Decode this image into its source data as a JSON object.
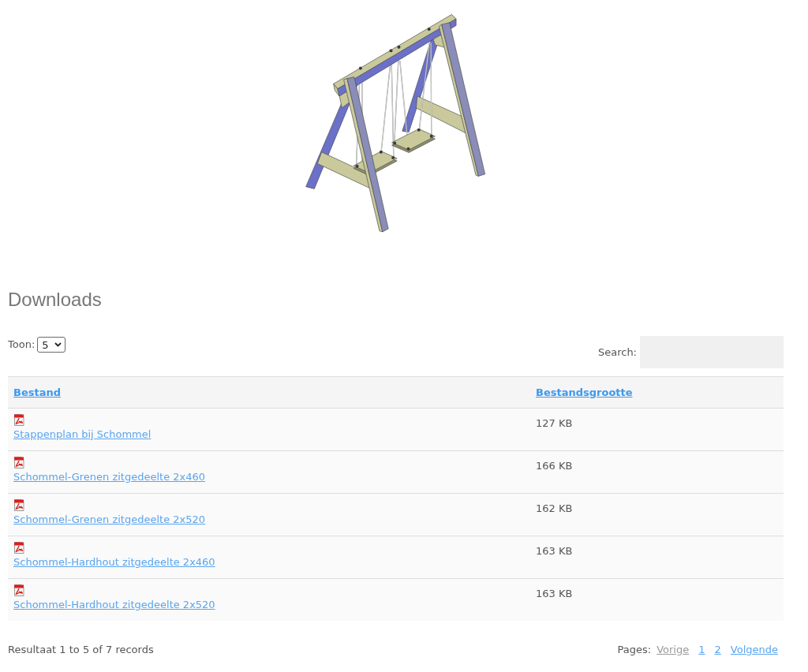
{
  "heading": "Downloads",
  "page_size": {
    "label": "Toon:",
    "value": "5"
  },
  "search": {
    "label": "Search:"
  },
  "table": {
    "columns": [
      "Bestand",
      "Bestandsgrootte"
    ],
    "rows": [
      {
        "file": "Stappenplan bij Schommel",
        "size": "127 KB"
      },
      {
        "file": "Schommel-Grenen zitgedeelte 2x460",
        "size": "166 KB"
      },
      {
        "file": "Schommel-Grenen zitgedeelte 2x520",
        "size": "162 KB"
      },
      {
        "file": "Schommel-Hardhout zitgedeelte 2x460",
        "size": "163 KB"
      },
      {
        "file": "Schommel-Hardhout zitgedeelte 2x520",
        "size": "163 KB"
      }
    ]
  },
  "footer": {
    "summary": "Resultaat 1 to 5 of 7 records",
    "pages_label": "Pages:",
    "links": [
      {
        "label": "Vorige",
        "disabled": true
      },
      {
        "label": "1",
        "disabled": false
      },
      {
        "label": "2",
        "disabled": false
      },
      {
        "label": "Volgende",
        "disabled": false
      }
    ]
  }
}
